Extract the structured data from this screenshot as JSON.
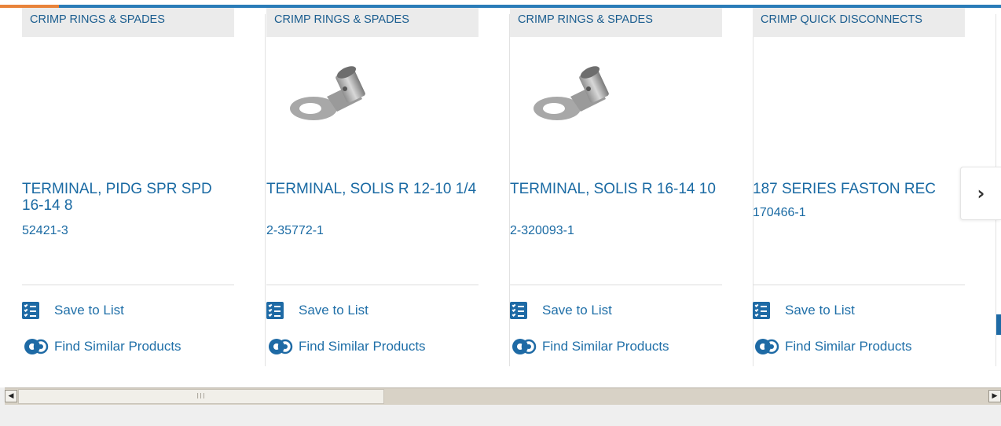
{
  "cards": [
    {
      "category": "CRIMP RINGS & SPADES",
      "title": "TERMINAL, PIDG SPR SPD 16-14 8",
      "part_number": "52421-3",
      "has_image": false,
      "save_label": "Save to List",
      "similar_label": "Find Similar Products"
    },
    {
      "category": "CRIMP RINGS & SPADES",
      "title": "TERMINAL, SOLIS R 12-10 1/4",
      "part_number": "2-35772-1",
      "has_image": true,
      "save_label": "Save to List",
      "similar_label": "Find Similar Products"
    },
    {
      "category": "CRIMP RINGS & SPADES",
      "title": "TERMINAL, SOLIS R 16-14 10",
      "part_number": "2-320093-1",
      "has_image": true,
      "save_label": "Save to List",
      "similar_label": "Find Similar Products"
    },
    {
      "category": "CRIMP QUICK DISCONNECTS",
      "title": "187 SERIES FASTON REC",
      "part_number": "170466-1",
      "has_image": false,
      "save_label": "Save to List",
      "similar_label": "Find Similar Products"
    }
  ],
  "carousel": {
    "next_icon": "chevron-right-icon",
    "next_glyph": "›"
  },
  "scrollbar": {
    "left_glyph": "◀",
    "right_glyph": "▶",
    "thumb_grip": "III"
  },
  "colors": {
    "link_blue": "#1a6aa3",
    "accent_orange": "#e8833a",
    "accent_blue": "#2a7cb8"
  }
}
